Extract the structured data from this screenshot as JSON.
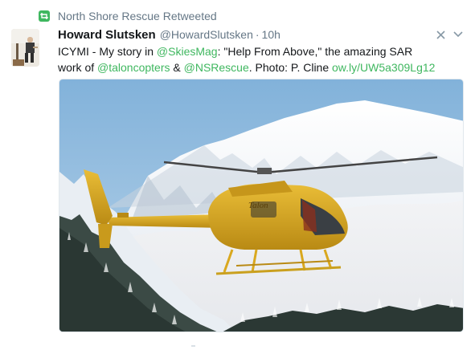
{
  "retweet": {
    "label": "North Shore Rescue Retweeted",
    "icon": "retweet-icon",
    "color": "#3fb75f"
  },
  "tweet": {
    "author_name": "Howard Slutsken",
    "author_handle": "@HowardSlutsken",
    "separator": "·",
    "time": "10h",
    "text_parts": {
      "t1": "ICYMI - My story in ",
      "l1": "@SkiesMag",
      "t2": ": \"Help From Above,\" the amazing SAR",
      "t3": "work of ",
      "l2": "@taloncopters",
      "t4": " & ",
      "l3": "@NSRescue",
      "t5": ". Photo: P. Cline ",
      "l4": "ow.ly/UW5a309Lg12"
    },
    "link_color": "#3fb75f",
    "media_description": "Helicopter flying in front of snow-covered mountains",
    "helicopter_tail_text": "Talon"
  },
  "controls": {
    "dismiss_icon": "close-icon",
    "menu_icon": "chevron-down-icon"
  },
  "colors": {
    "text": "#14171a",
    "muted": "#657786",
    "sky": "#8bb8dc",
    "helicopter": "#d9a81f"
  }
}
